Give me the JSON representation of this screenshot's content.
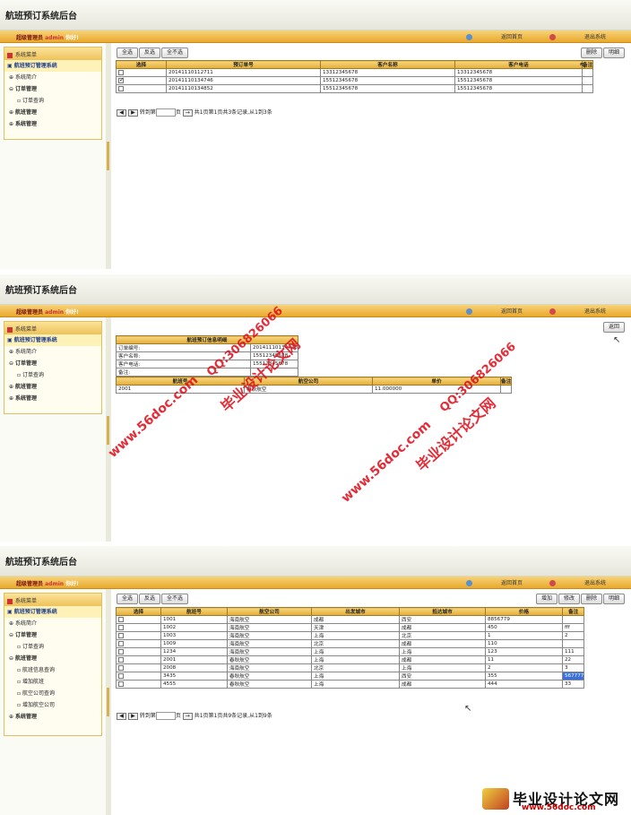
{
  "app": {
    "title": "航班预订系统后台",
    "user_label": "超级管理员",
    "user_name": "admin",
    "greeting": "你好!",
    "home_link": "返回首页",
    "logout_link": "退出系统"
  },
  "sidebar": {
    "header": "系统菜单",
    "root": "航班预订管理系统",
    "intro": "系统简介",
    "orders": "订单管理",
    "order_query": "订单查询",
    "flights": "航班管理",
    "system": "系统管理",
    "flight_query": "航班信息查询",
    "add_flight": "增加航班",
    "airline_query": "航空公司查询",
    "add_airline": "增加航空公司"
  },
  "toolbar": {
    "select_all": "全选",
    "invert": "反选",
    "select_none": "全不选",
    "delete": "删除",
    "detail": "明细",
    "back": "返回",
    "add": "增加",
    "edit": "修改"
  },
  "orders": {
    "headers": [
      "选择",
      "预订单号",
      "客户名称",
      "客户电话",
      "备注"
    ],
    "rows": [
      {
        "checked": false,
        "cells": [
          "20141110112711",
          "13312345678",
          "13312345678",
          ""
        ]
      },
      {
        "checked": true,
        "cells": [
          "20141110134746",
          "15512345678",
          "15512345678",
          ""
        ]
      },
      {
        "checked": false,
        "cells": [
          "20141110134852",
          "15512345678",
          "15512345678",
          ""
        ]
      }
    ],
    "pager_goto": "转到第",
    "pager_page": "页",
    "pager_info": "共1页第1页共3条记录,从1到3条"
  },
  "detail": {
    "title": "航班预订信息明细",
    "fields": [
      {
        "label": "订单编号:",
        "value": "20141110134746"
      },
      {
        "label": "客户名称:",
        "value": "15512345678"
      },
      {
        "label": "客户电话:",
        "value": "15512345678"
      },
      {
        "label": "备注:",
        "value": ""
      }
    ],
    "item_headers": [
      "航班号",
      "航空公司",
      "单价",
      "备注"
    ],
    "items": [
      [
        "2001",
        "春秋航空",
        "11.000000",
        ""
      ]
    ]
  },
  "flights": {
    "headers": [
      "选择",
      "航班号",
      "航空公司",
      "出发城市",
      "抵达城市",
      "价格",
      "备注"
    ],
    "rows": [
      [
        "1001",
        "海南航空",
        "成都",
        "西安",
        "8856779",
        ""
      ],
      [
        "1002",
        "海南航空",
        "天津",
        "成都",
        "450",
        "fff"
      ],
      [
        "1003",
        "海南航空",
        "上海",
        "北京",
        "1",
        "2"
      ],
      [
        "1009",
        "海南航空",
        "北京",
        "成都",
        "110",
        ""
      ],
      [
        "1234",
        "海南航空",
        "上海",
        "上海",
        "123",
        "111"
      ],
      [
        "2001",
        "春秋航空",
        "上海",
        "成都",
        "11",
        "22"
      ],
      [
        "2008",
        "海南航空",
        "北京",
        "上海",
        "2",
        "3"
      ],
      [
        "3435",
        "春秋航空",
        "上海",
        "西安",
        "355",
        "567777"
      ],
      [
        "4555",
        "春秋航空",
        "上海",
        "成都",
        "444",
        "33"
      ]
    ],
    "pager_goto": "转到第",
    "pager_page": "页",
    "pager_info": "共1页第1页共9条记录,从1到9条"
  },
  "watermark": {
    "site": "www.56doc.com",
    "qq": "QQ:306826066",
    "brand": "毕业设计论文网"
  },
  "footer_logo": {
    "text": "毕业设计论文网",
    "url": "www.56doc.com"
  }
}
